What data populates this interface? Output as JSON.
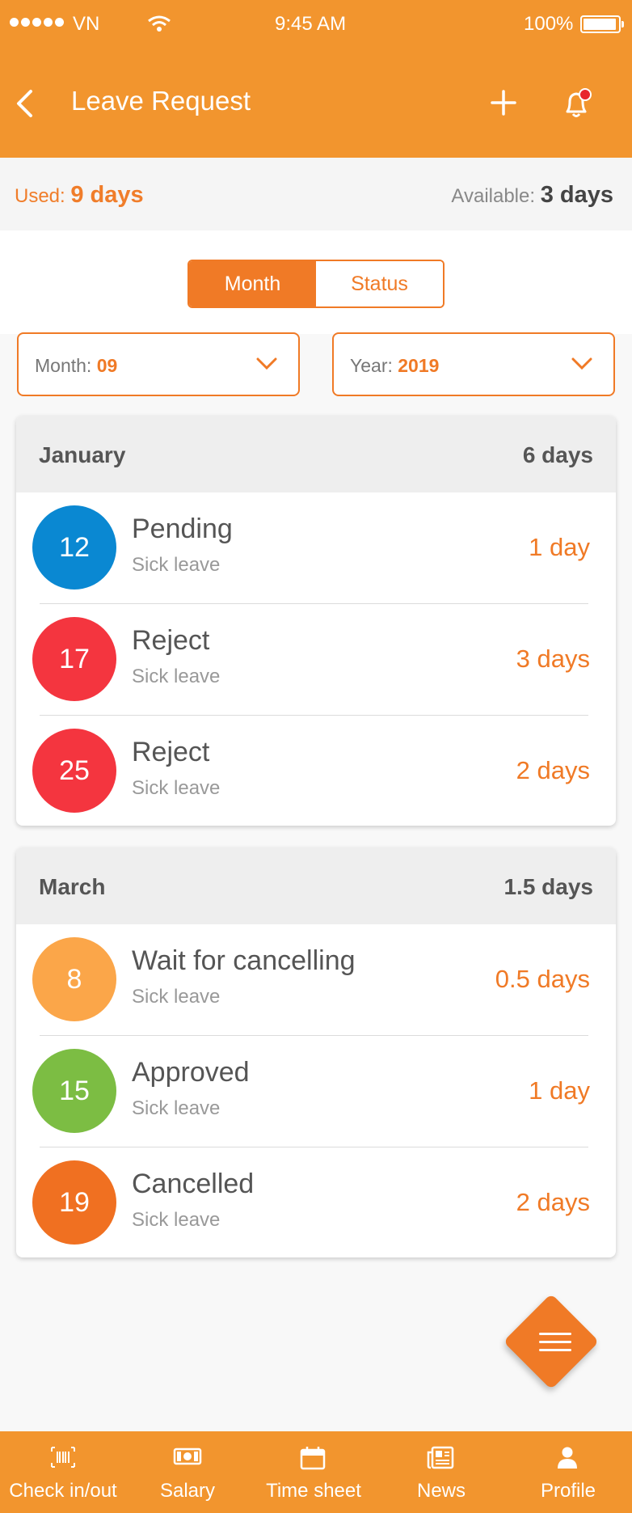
{
  "status_bar": {
    "carrier": "VN",
    "time": "9:45 AM",
    "battery": "100%"
  },
  "header": {
    "title": "Leave Request"
  },
  "summary": {
    "used_label": "Used:",
    "used_value": "9 days",
    "available_label": "Available:",
    "available_value": "3 days"
  },
  "segments": {
    "month": "Month",
    "status": "Status",
    "selected": "Month"
  },
  "filters": {
    "month_label": "Month:",
    "month_value": "09",
    "year_label": "Year:",
    "year_value": "2019"
  },
  "groups": [
    {
      "month": "January",
      "total": "6 days",
      "items": [
        {
          "day": "12",
          "status": "Pending",
          "type": "Sick leave",
          "duration": "1 day",
          "color": "#0a88d2"
        },
        {
          "day": "17",
          "status": "Reject",
          "type": "Sick leave",
          "duration": "3 days",
          "color": "#f4353f"
        },
        {
          "day": "25",
          "status": "Reject",
          "type": "Sick leave",
          "duration": "2 days",
          "color": "#f4353f"
        }
      ]
    },
    {
      "month": "March",
      "total": "1.5 days",
      "items": [
        {
          "day": "8",
          "status": "Wait for cancelling",
          "type": "Sick leave",
          "duration": "0.5 days",
          "color": "#fba649"
        },
        {
          "day": "15",
          "status": "Approved",
          "type": "Sick leave",
          "duration": "1 day",
          "color": "#7cbd43"
        },
        {
          "day": "19",
          "status": "Cancelled",
          "type": "Sick leave",
          "duration": "2 days",
          "color": "#f07021"
        }
      ]
    }
  ],
  "tabbar": {
    "items": [
      {
        "label": "Check in/out",
        "icon": "barcode-icon"
      },
      {
        "label": "Salary",
        "icon": "money-icon"
      },
      {
        "label": "Time sheet",
        "icon": "calendar-icon"
      },
      {
        "label": "News",
        "icon": "newspaper-icon"
      },
      {
        "label": "Profile",
        "icon": "person-icon"
      }
    ]
  },
  "colors": {
    "brand": "#f2952e",
    "accent": "#f07a26",
    "notification_dot": "#e8262d"
  }
}
